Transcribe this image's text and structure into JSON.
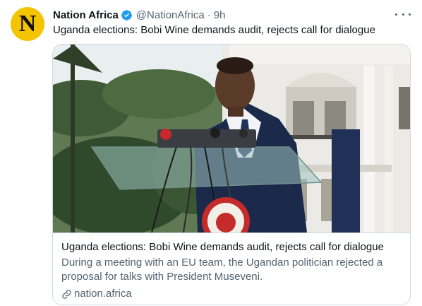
{
  "tweet": {
    "avatar": {
      "letter": "N",
      "background": "#f5c400"
    },
    "display_name": "Nation Africa",
    "verified_icon": "verified-badge-icon",
    "handle": "@NationAfrica",
    "separator": "·",
    "timestamp": "9h",
    "more_icon": "more-options-icon",
    "text": "Uganda elections: Bobi Wine demands audit, rejects call for dialogue",
    "card": {
      "image_description_icon": "article-photo",
      "title": "Uganda elections: Bobi Wine demands audit, rejects call for dialogue",
      "description": "During a meeting with an EU team, the Ugandan politician rejected a proposal for talks with President Museveni.",
      "link_icon": "link-icon",
      "domain": "nation.africa"
    }
  },
  "colors": {
    "text_primary": "#0f1419",
    "text_secondary": "#536471",
    "verified_blue": "#1d9bf0",
    "card_border": "#cfd9de"
  }
}
